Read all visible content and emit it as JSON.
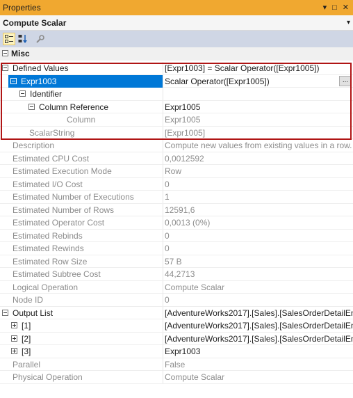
{
  "window": {
    "title": "Properties",
    "controls": [
      "▾",
      "□",
      "✕"
    ]
  },
  "object": {
    "name": "Compute Scalar",
    "dropdown_arrow": "▾"
  },
  "toolbar": {
    "buttons": [
      "categorized-icon",
      "alphabetical-icon",
      "property-pages-icon"
    ]
  },
  "category": {
    "name": "Misc"
  },
  "rows": [
    {
      "name": "Defined Values",
      "value": "[Expr1003] = Scalar Operator([Expr1005])"
    },
    {
      "name": "Expr1003",
      "value": "Scalar Operator([Expr1005])",
      "button": "..."
    },
    {
      "name": "Identifier",
      "value": ""
    },
    {
      "name": "Column Reference",
      "value": "Expr1005"
    },
    {
      "name": "Column",
      "value": "Expr1005"
    },
    {
      "name": "ScalarString",
      "value": "[Expr1005]"
    },
    {
      "name": "Description",
      "value": "Compute new values from existing values in a row."
    },
    {
      "name": "Estimated CPU Cost",
      "value": "0,0012592"
    },
    {
      "name": "Estimated Execution Mode",
      "value": "Row"
    },
    {
      "name": "Estimated I/O Cost",
      "value": "0"
    },
    {
      "name": "Estimated Number of Executions",
      "value": "1"
    },
    {
      "name": "Estimated Number of Rows",
      "value": "12591,6"
    },
    {
      "name": "Estimated Operator Cost",
      "value": "0,0013 (0%)"
    },
    {
      "name": "Estimated Rebinds",
      "value": "0"
    },
    {
      "name": "Estimated Rewinds",
      "value": "0"
    },
    {
      "name": "Estimated Row Size",
      "value": "57 B"
    },
    {
      "name": "Estimated Subtree Cost",
      "value": "44,2713"
    },
    {
      "name": "Logical Operation",
      "value": "Compute Scalar"
    },
    {
      "name": "Node ID",
      "value": "0"
    },
    {
      "name": "Output List",
      "value": "[AdventureWorks2017].[Sales].[SalesOrderDetailEnl"
    },
    {
      "name": "[1]",
      "value": "[AdventureWorks2017].[Sales].[SalesOrderDetailEnl"
    },
    {
      "name": "[2]",
      "value": "[AdventureWorks2017].[Sales].[SalesOrderDetailEnl"
    },
    {
      "name": "[3]",
      "value": "Expr1003"
    },
    {
      "name": "Parallel",
      "value": "False"
    },
    {
      "name": "Physical Operation",
      "value": "Compute Scalar"
    }
  ],
  "colors": {
    "titlebar": "#f0a830",
    "selection": "#0078d7",
    "highlight_box": "#b01515",
    "toolbar": "#cfd6e5"
  }
}
